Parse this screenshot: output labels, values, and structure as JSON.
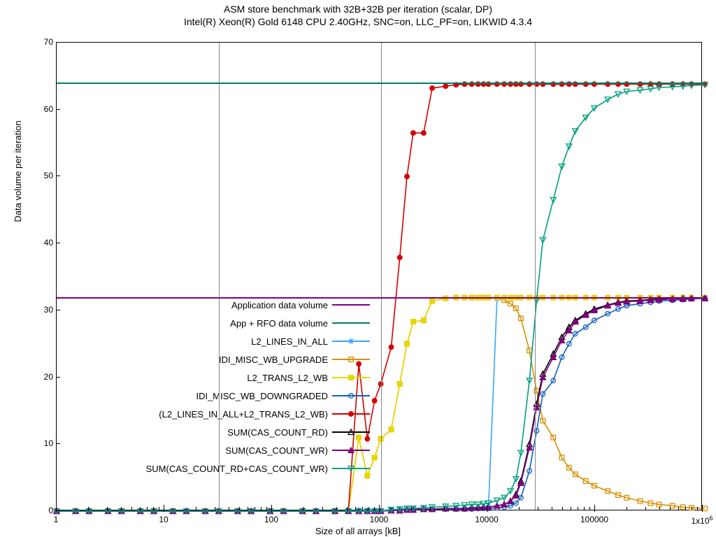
{
  "title_line1": "ASM store benchmark with 32B+32B per iteration (scalar, DP)",
  "title_line2": "Intel(R) Xeon(R) Gold 6148 CPU  2.40GHz, SNC=on, LLC_PF=on, LIKWID 4.3.4",
  "xlabel": "Size of all arrays [kB]",
  "ylabel": "Data volume per iteration",
  "legend": {
    "app": "Application data volume",
    "rfo": "App + RFO data volume",
    "l2in": "L2_LINES_IN_ALL",
    "wbu": "IDI_MISC_WB_UPGRADE",
    "l2wb": "L2_TRANS_L2_WB",
    "wbd": "IDI_MISC_WB_DOWNGRADED",
    "sum_l2": "(L2_LINES_IN_ALL+L2_TRANS_L2_WB)",
    "rd": "SUM(CAS_COUNT_RD)",
    "wr": "SUM(CAS_COUNT_WR)",
    "sum_cas": "SUM(CAS_COUNT_RD+CAS_COUNT_WR)"
  },
  "xtick_labels": {
    "1": "1",
    "10": "10",
    "100": "100",
    "1000": "1000",
    "10000": "10000",
    "100000": "100000",
    "1e6": "1x10"
  },
  "xtick_exp6": "6",
  "ytick_labels": {
    "0": "0",
    "10": "10",
    "20": "20",
    "30": "30",
    "40": "40",
    "50": "50",
    "60": "60",
    "70": "70"
  },
  "chart_data": {
    "type": "line",
    "xlabel": "Size of all arrays [kB]",
    "ylabel": "Data volume per iteration",
    "title": "ASM store benchmark with 32B+32B per iteration (scalar, DP)",
    "subtitle": "Intel(R) Xeon(R) Gold 6148 CPU 2.40GHz, SNC=on, LLC_PF=on, LIKWID 4.3.4",
    "xscale": "log10",
    "xlim": [
      1,
      1000000
    ],
    "ylim": [
      0,
      70
    ],
    "vlines_kB": [
      32,
      1024,
      27500
    ],
    "hlines": {
      "Application data volume": 32,
      "App + RFO data volume": 64
    },
    "x": [
      1,
      1.5,
      2,
      3,
      4,
      6,
      8,
      12,
      16,
      24,
      32,
      48,
      64,
      96,
      128,
      192,
      256,
      384,
      512,
      640,
      768,
      896,
      1024,
      1280,
      1536,
      1792,
      2048,
      2560,
      3072,
      4096,
      5120,
      6144,
      7168,
      8192,
      9216,
      10240,
      12288,
      14336,
      16384,
      18432,
      20480,
      24576,
      28672,
      32768,
      40960,
      49152,
      57344,
      65536,
      81920,
      98304,
      131072,
      163840,
      196608,
      262144,
      327680,
      393216,
      524288,
      655360,
      786432,
      1048576
    ],
    "series": [
      {
        "name": "Application data volume",
        "color": "#800080",
        "const": 32
      },
      {
        "name": "App + RFO data volume",
        "color": "#008066",
        "const": 64
      },
      {
        "name": "L2_LINES_IN_ALL",
        "color": "#3aa6ff",
        "marker": "asterisk",
        "values": [
          0,
          0,
          0,
          0,
          0,
          0,
          0,
          0,
          0,
          0,
          0,
          0,
          0,
          0,
          0,
          0,
          0,
          0,
          0,
          0.1,
          0.1,
          0.1,
          0.1,
          0.2,
          0.2,
          0.2,
          0.3,
          0.3,
          0.3,
          0.3,
          0.4,
          0.4,
          0.4,
          0.4,
          0.5,
          0.5,
          31.7,
          31.8,
          31.9,
          31.9,
          31.9,
          31.9,
          31.9,
          31.9,
          31.9,
          31.9,
          31.9,
          31.9,
          31.9,
          31.9,
          31.9,
          31.9,
          31.9,
          31.9,
          31.9,
          31.9,
          31.9,
          31.9,
          31.9,
          31.9
        ]
      },
      {
        "name": "IDI_MISC_WB_UPGRADE",
        "color": "#d78f00",
        "marker": "open-square",
        "values": [
          0,
          0,
          0,
          0,
          0,
          0,
          0,
          0,
          0,
          0,
          0,
          0,
          0,
          0,
          0,
          0,
          0,
          0,
          0,
          11,
          5.3,
          8,
          10.8,
          12.2,
          19,
          25,
          28.3,
          28.5,
          31.4,
          31.8,
          31.9,
          31.9,
          31.9,
          31.9,
          31.9,
          31.9,
          31.9,
          31.5,
          31.0,
          30.3,
          28.8,
          24.0,
          18.0,
          13.5,
          11.0,
          8.0,
          6.5,
          5.5,
          4.5,
          3.8,
          3.0,
          2.4,
          2.0,
          1.5,
          1.2,
          1.0,
          0.8,
          0.6,
          0.5,
          0.4
        ]
      },
      {
        "name": "L2_TRANS_L2_WB",
        "color": "#e8d600",
        "marker": "filled-square",
        "values": [
          0,
          0,
          0,
          0,
          0,
          0,
          0,
          0,
          0,
          0,
          0,
          0,
          0,
          0,
          0,
          0,
          0,
          0,
          0,
          11,
          5.3,
          8,
          10.8,
          12.2,
          19,
          25,
          28.3,
          28.5,
          31.4,
          31.8,
          31.9,
          31.9,
          31.9,
          31.9,
          31.9,
          31.9,
          31.9,
          31.9,
          31.9,
          31.9,
          31.9,
          31.9,
          31.9,
          31.9,
          31.9,
          31.9,
          31.9,
          31.9,
          31.9,
          31.9,
          31.9,
          31.9,
          31.9,
          31.9,
          31.9,
          31.9,
          31.9,
          31.9,
          31.9,
          31.9
        ]
      },
      {
        "name": "IDI_MISC_WB_DOWNGRADED",
        "color": "#1060c0",
        "marker": "open-circle",
        "values": [
          0,
          0,
          0,
          0,
          0,
          0,
          0,
          0,
          0,
          0,
          0,
          0,
          0,
          0,
          0,
          0,
          0,
          0,
          0,
          0,
          0,
          0,
          0,
          0.1,
          0.1,
          0.2,
          0.2,
          0.3,
          0.3,
          0.3,
          0.3,
          0.3,
          0.3,
          0.4,
          0.4,
          0.4,
          0.5,
          0.6,
          0.8,
          1.2,
          2.0,
          6.0,
          12.0,
          17.5,
          19.5,
          23.0,
          25.0,
          26.5,
          27.5,
          28.5,
          29.5,
          30.2,
          30.7,
          31.0,
          31.2,
          31.4,
          31.5,
          31.6,
          31.7,
          31.8
        ]
      },
      {
        "name": "(L2_LINES_IN_ALL+L2_TRANS_L2_WB)",
        "color": "#d40000",
        "marker": "filled-circle",
        "values": [
          0,
          0,
          0,
          0,
          0,
          0,
          0,
          0,
          0,
          0,
          0,
          0,
          0,
          0,
          0,
          0,
          0,
          0,
          0,
          22,
          10.8,
          16.5,
          19,
          24.5,
          37.9,
          50,
          56.5,
          56.5,
          63.2,
          63.5,
          63.7,
          63.8,
          63.8,
          63.8,
          63.8,
          63.8,
          63.8,
          63.8,
          63.8,
          63.8,
          63.8,
          63.8,
          63.8,
          63.8,
          63.8,
          63.8,
          63.8,
          63.8,
          63.8,
          63.8,
          63.8,
          63.8,
          63.8,
          63.8,
          63.8,
          63.8,
          63.8,
          63.8,
          63.8,
          63.8
        ]
      },
      {
        "name": "SUM(CAS_COUNT_RD)",
        "color": "#000000",
        "marker": "open-triangle",
        "values": [
          0,
          0,
          0,
          0,
          0,
          0,
          0,
          0,
          0,
          0,
          0,
          0,
          0,
          0,
          0,
          0,
          0,
          0,
          0,
          0,
          0,
          0,
          0,
          0.1,
          0.1,
          0.2,
          0.2,
          0.3,
          0.3,
          0.4,
          0.4,
          0.4,
          0.5,
          0.5,
          0.6,
          0.6,
          0.8,
          1.0,
          1.5,
          2.5,
          4.5,
          10.0,
          16.0,
          20.5,
          23.5,
          26.0,
          27.5,
          28.5,
          29.5,
          30.2,
          30.8,
          31.2,
          31.4,
          31.5,
          31.6,
          31.7,
          31.7,
          31.8,
          31.8,
          31.8
        ]
      },
      {
        "name": "SUM(CAS_COUNT_WR)",
        "color": "#800080",
        "marker": "filled-triangle",
        "values": [
          0,
          0,
          0,
          0,
          0,
          0,
          0,
          0,
          0,
          0,
          0,
          0,
          0,
          0,
          0,
          0,
          0,
          0,
          0,
          0,
          0,
          0,
          0,
          0.1,
          0.1,
          0.2,
          0.2,
          0.3,
          0.3,
          0.4,
          0.4,
          0.4,
          0.5,
          0.5,
          0.6,
          0.6,
          0.8,
          1.0,
          1.5,
          2.3,
          4.2,
          9.5,
          15.5,
          20.0,
          23.0,
          25.5,
          27.0,
          28.3,
          29.3,
          30.0,
          30.7,
          31.1,
          31.3,
          31.4,
          31.5,
          31.6,
          31.7,
          31.7,
          31.8,
          31.8
        ]
      },
      {
        "name": "SUM(CAS_COUNT_RD+CAS_COUNT_WR)",
        "color": "#00a080",
        "marker": "down-triangle",
        "values": [
          0,
          0,
          0,
          0,
          0,
          0,
          0,
          0,
          0,
          0,
          0,
          0,
          0,
          0,
          0,
          0,
          0,
          0,
          0,
          0,
          0,
          0,
          0,
          0.2,
          0.3,
          0.4,
          0.4,
          0.5,
          0.6,
          0.7,
          0.8,
          0.9,
          1.0,
          1.0,
          1.1,
          1.2,
          1.6,
          2.0,
          3.0,
          4.8,
          8.7,
          19.5,
          31.5,
          40.5,
          46.5,
          51.5,
          54.5,
          56.8,
          58.8,
          60.2,
          61.5,
          62.3,
          62.7,
          62.9,
          63.1,
          63.3,
          63.4,
          63.5,
          63.6,
          63.7
        ]
      }
    ]
  }
}
